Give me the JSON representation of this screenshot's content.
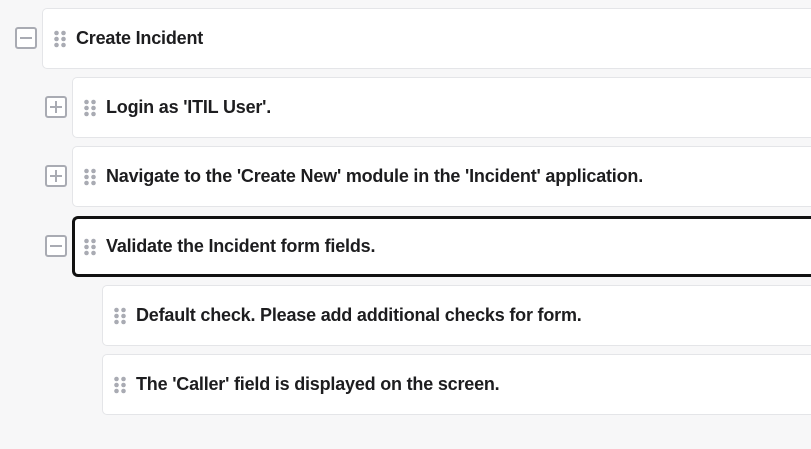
{
  "tree": {
    "root": {
      "label": "Create Incident",
      "toggle": "collapse",
      "steps": [
        {
          "label": "Login as 'ITIL User'.",
          "toggle": "expand",
          "selected": false
        },
        {
          "label": "Navigate to the 'Create New' module in the 'Incident' application.",
          "toggle": "expand",
          "selected": false
        },
        {
          "label": "Validate the Incident form fields.",
          "toggle": "collapse",
          "selected": true,
          "checks": [
            {
              "label": "Default check. Please add additional checks for form."
            },
            {
              "label": "The 'Caller' field is displayed on the screen."
            }
          ]
        }
      ]
    }
  },
  "icons": {
    "expand": "plus-icon",
    "collapse": "minus-icon",
    "drag": "drag-handle-icon"
  },
  "colors": {
    "background": "#f7f7f8",
    "card": "#ffffff",
    "card_border": "#e4e5e8",
    "selected_border": "#111111",
    "icon": "#a9abb3",
    "text": "#1d1d1f"
  }
}
